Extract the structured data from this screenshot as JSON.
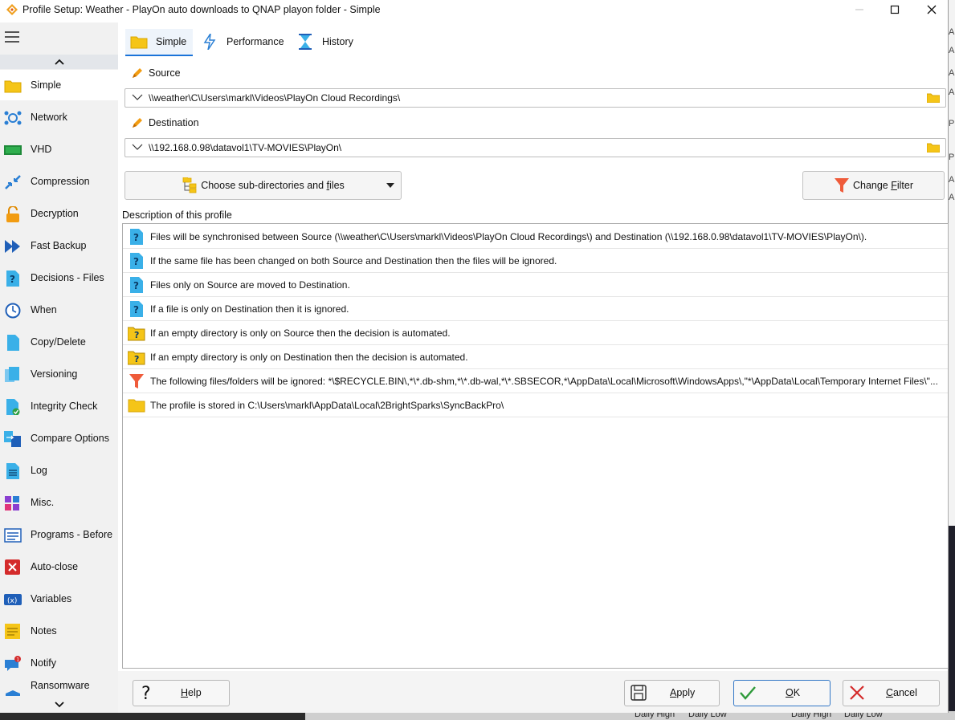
{
  "window": {
    "title": "Profile Setup: Weather - PlayOn auto downloads to QNAP playon folder - Simple"
  },
  "tabs": [
    {
      "label": "Simple",
      "active": true,
      "icon": "folder-icon"
    },
    {
      "label": "Performance",
      "active": false,
      "icon": "lightning-icon"
    },
    {
      "label": "History",
      "active": false,
      "icon": "hourglass-icon"
    }
  ],
  "sidebar": {
    "items": [
      {
        "label": "Simple",
        "icon": "folder-icon",
        "active": true
      },
      {
        "label": "Network",
        "icon": "network-icon"
      },
      {
        "label": "VHD",
        "icon": "vhd-icon"
      },
      {
        "label": "Compression",
        "icon": "compression-icon"
      },
      {
        "label": "Decryption",
        "icon": "lock-icon"
      },
      {
        "label": "Fast Backup",
        "icon": "fast-forward-icon"
      },
      {
        "label": "Decisions - Files",
        "icon": "question-document-icon"
      },
      {
        "label": "When",
        "icon": "clock-icon"
      },
      {
        "label": "Copy/Delete",
        "icon": "document-icon"
      },
      {
        "label": "Versioning",
        "icon": "versions-icon"
      },
      {
        "label": "Integrity Check",
        "icon": "integrity-check-icon"
      },
      {
        "label": "Compare Options",
        "icon": "compare-icon"
      },
      {
        "label": "Log",
        "icon": "log-icon"
      },
      {
        "label": "Misc.",
        "icon": "misc-icon"
      },
      {
        "label": "Programs - Before",
        "icon": "programs-icon"
      },
      {
        "label": "Auto-close",
        "icon": "close-box-icon"
      },
      {
        "label": "Variables",
        "icon": "variables-icon"
      },
      {
        "label": "Notes",
        "icon": "notes-icon"
      },
      {
        "label": "Notify",
        "icon": "notify-icon",
        "badge": "1"
      },
      {
        "label": "Ransomware",
        "icon": "ransomware-icon"
      }
    ]
  },
  "source": {
    "label": "Source",
    "path": "\\\\weather\\C\\Users\\markl\\Videos\\PlayOn Cloud Recordings\\"
  },
  "destination": {
    "label": "Destination",
    "path": "\\\\192.168.0.98\\datavol1\\TV-MOVIES\\PlayOn\\"
  },
  "buttons": {
    "choose_before": "Choose sub-directories and ",
    "choose_acc": "f",
    "choose_after": "iles",
    "filter_before": "Change ",
    "filter_acc": "F",
    "filter_after": "ilter",
    "help_acc": "H",
    "help_after": "elp",
    "apply_acc": "A",
    "apply_after": "pply",
    "ok_acc": "O",
    "ok_after": "K",
    "cancel_acc": "C",
    "cancel_after": "ancel"
  },
  "description": {
    "label": "Description of this profile",
    "rows": [
      {
        "icon": "info-question-icon",
        "text": "Files will be synchronised between Source (\\\\weather\\C\\Users\\markl\\Videos\\PlayOn Cloud Recordings\\) and Destination (\\\\192.168.0.98\\datavol1\\TV-MOVIES\\PlayOn\\)."
      },
      {
        "icon": "info-question-icon",
        "text": "If the same file has been changed on both Source and Destination then the files will be ignored."
      },
      {
        "icon": "info-question-icon",
        "text": "Files only on Source are moved to Destination."
      },
      {
        "icon": "info-question-icon",
        "text": "If a file is only on Destination then it is ignored."
      },
      {
        "icon": "folder-question-icon",
        "text": "If an empty directory is only on Source then the decision is automated."
      },
      {
        "icon": "folder-question-icon",
        "text": "If an empty directory is only on Destination then the decision is automated."
      },
      {
        "icon": "filter-icon",
        "text": "The following files/folders will be ignored: *\\$RECYCLE.BIN\\,*\\*.db-shm,*\\*.db-wal,*\\*.SBSECOR,*\\AppData\\Local\\Microsoft\\WindowsApps\\,\"*\\AppData\\Local\\Temporary Internet Files\\\"..."
      },
      {
        "icon": "folder-icon",
        "text": "The profile is stored in C:\\Users\\markl\\AppData\\Local\\2BrightSparks\\SyncBackPro\\"
      }
    ]
  },
  "background": {
    "letters": [
      "A",
      "A",
      "A",
      "A",
      "P",
      "P",
      "A",
      "A"
    ],
    "strip_labels": [
      "Daily High",
      "Daily Low",
      "Daily High",
      "Daily Low"
    ]
  }
}
